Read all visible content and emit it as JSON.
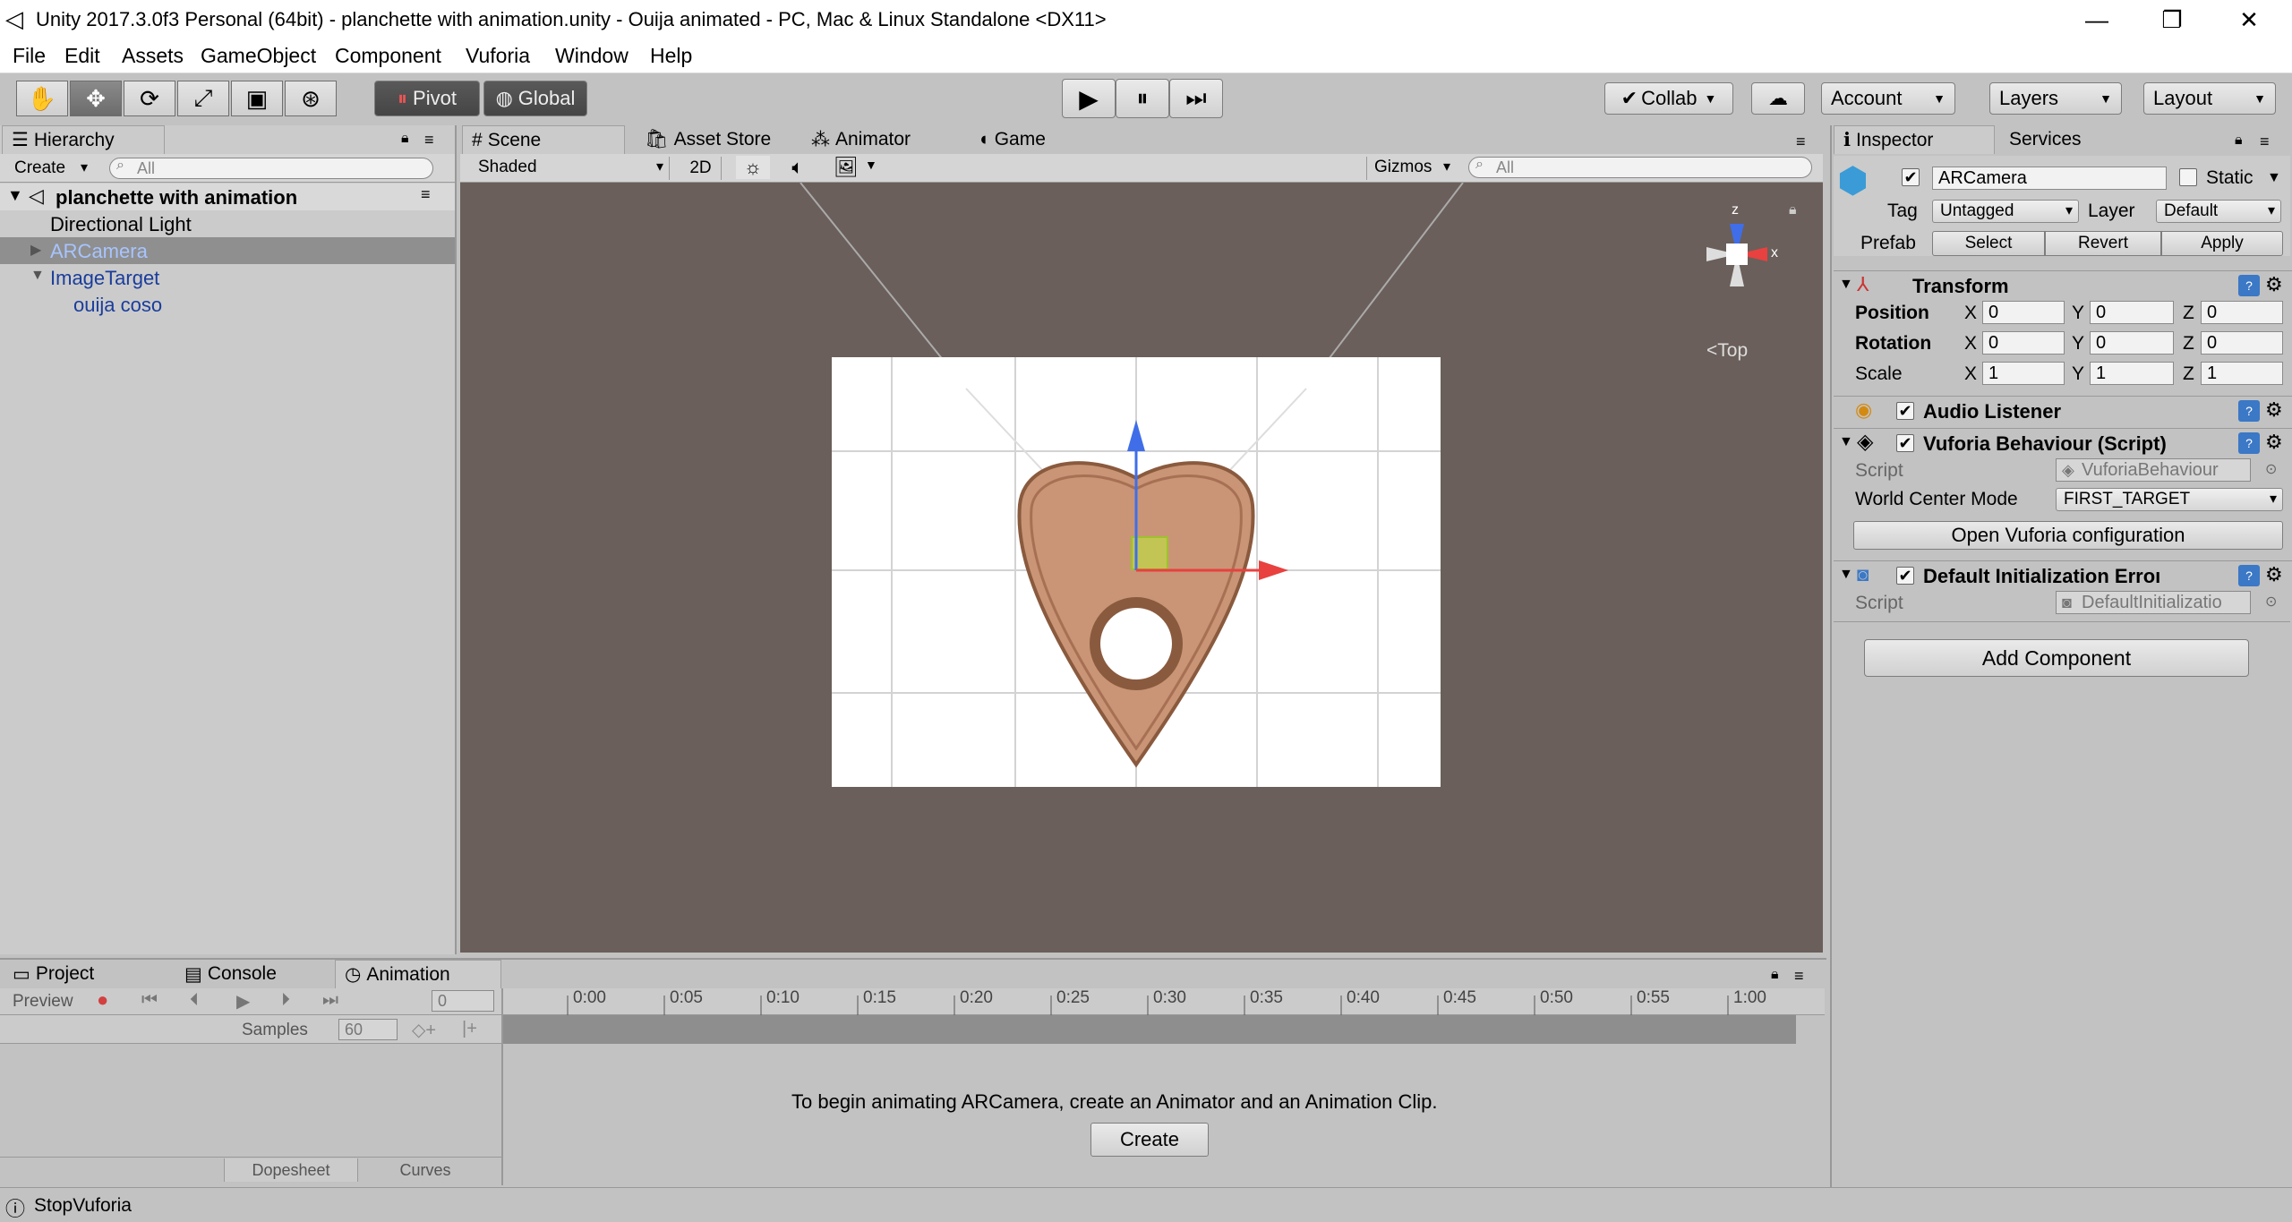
{
  "window": {
    "title": "Unity 2017.3.0f3 Personal (64bit) - planchette with animation.unity - Ouija animated - PC, Mac & Linux Standalone <DX11>",
    "min": "—",
    "max": "❐",
    "close": "✕"
  },
  "menu": [
    "File",
    "Edit",
    "Assets",
    "GameObject",
    "Component",
    "Vuforia",
    "Window",
    "Help"
  ],
  "toolbar": {
    "pivot": "Pivot",
    "global": "Global",
    "collab": "Collab",
    "account": "Account",
    "layers": "Layers",
    "layout": "Layout"
  },
  "hierarchy": {
    "tab": "Hierarchy",
    "create": "Create",
    "search_placeholder": "All",
    "scene": "planchette with animation",
    "items": [
      {
        "label": "Directional Light"
      },
      {
        "label": "ARCamera"
      },
      {
        "label": "ImageTarget"
      },
      {
        "label": "ouija coso"
      }
    ]
  },
  "scene_tabs": {
    "scene": "Scene",
    "asset_store": "Asset Store",
    "animator": "Animator",
    "game": "Game"
  },
  "scene_bar": {
    "shaded": "Shaded",
    "twod": "2D",
    "gizmos": "Gizmos",
    "search_placeholder": "All"
  },
  "gizmo": {
    "z": "z",
    "x": "x",
    "view": "Top"
  },
  "inspector": {
    "tab": "Inspector",
    "services": "Services",
    "name": "ARCamera",
    "static": "Static",
    "tag_label": "Tag",
    "tag": "Untagged",
    "layer_label": "Layer",
    "layer": "Default",
    "prefab_label": "Prefab",
    "select": "Select",
    "revert": "Revert",
    "apply": "Apply",
    "transform": {
      "title": "Transform",
      "position": "Position",
      "rotation": "Rotation",
      "scale": "Scale",
      "x": "X",
      "y": "Y",
      "z": "Z",
      "pos": [
        "0",
        "0",
        "0"
      ],
      "rot": [
        "0",
        "0",
        "0"
      ],
      "scl": [
        "1",
        "1",
        "1"
      ]
    },
    "audio_listener": "Audio Listener",
    "vuforia": {
      "title": "Vuforia Behaviour (Script)",
      "script_label": "Script",
      "script": "VuforiaBehaviour",
      "wcm_label": "World Center Mode",
      "wcm": "FIRST_TARGET",
      "open_btn": "Open Vuforia configuration"
    },
    "die": {
      "title": "Default Initialization Erroı",
      "script_label": "Script",
      "script": "DefaultInitializatio"
    },
    "add_component": "Add Component"
  },
  "bottom_tabs": {
    "project": "Project",
    "console": "Console",
    "animation": "Animation"
  },
  "animation": {
    "preview": "Preview",
    "frame": "0",
    "samples_label": "Samples",
    "samples": "60",
    "dopesheet": "Dopesheet",
    "curves": "Curves",
    "message": "To begin animating ARCamera, create an Animator and an Animation Clip.",
    "create": "Create",
    "ticks": [
      "0:00",
      "0:05",
      "0:10",
      "0:15",
      "0:20",
      "0:25",
      "0:30",
      "0:35",
      "0:40",
      "0:45",
      "0:50",
      "0:55",
      "1:00"
    ]
  },
  "status": {
    "text": "StopVuforia"
  }
}
